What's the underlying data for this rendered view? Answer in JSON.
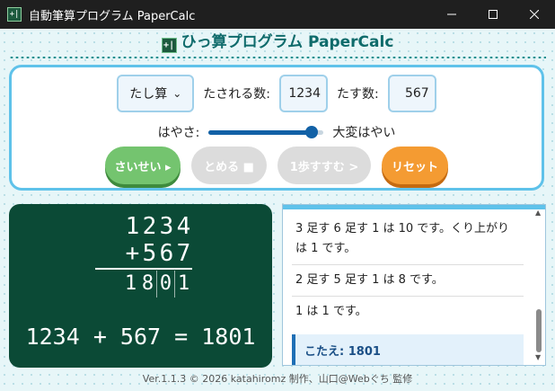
{
  "window": {
    "title": "自動筆算プログラム PaperCalc",
    "icon": "+|"
  },
  "header": {
    "title": "ひっ算プログラム PaperCalc",
    "icon": "+|"
  },
  "controls": {
    "operation": "たし算",
    "operation_arrow": "⌄",
    "label_a": "たされる数:",
    "value_a": "1234",
    "label_b": "たす数:",
    "value_b": "567",
    "speed_label": "はやさ:",
    "speed_value_text": "大変はやい",
    "speed_level": 0.9,
    "start_label": "さいせい ▸",
    "stop_label": "とめる ■",
    "step_label": "1歩すすむ >",
    "reset_label": "リセット"
  },
  "board": {
    "row_a": [
      "1",
      "2",
      "3",
      "4"
    ],
    "row_b_op": "+",
    "row_b": [
      "5",
      "6",
      "7"
    ],
    "row_r": [
      "1",
      "8",
      "0",
      "1"
    ],
    "equation": "1234 + 567 = 1801"
  },
  "log": {
    "items": [
      "3 足す 6 足す 1 は 10 です。くり上がりは 1 です。",
      "2 足す 5 足す 1 は 8 です。",
      "1 は 1 です。"
    ],
    "answer": "こたえ: 1801"
  },
  "footer": "Ver.1.1.3 © 2026 katahiromz 制作、山口@Webぐち 監修",
  "colors": {
    "accent": "#5fc2ea",
    "board": "#0b4a36",
    "start": "#74c46f",
    "reset": "#f49b32",
    "slider": "#1261a6"
  }
}
